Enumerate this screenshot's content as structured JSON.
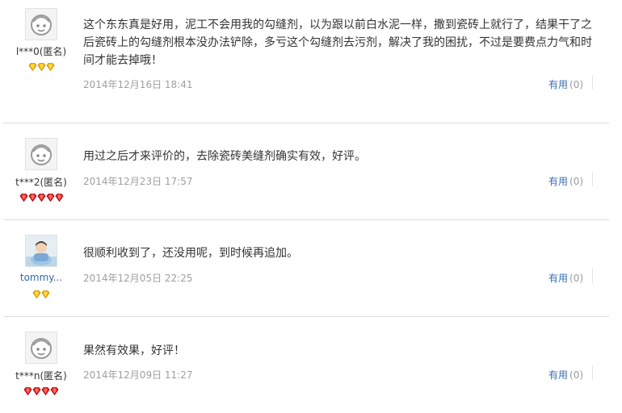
{
  "reviews": [
    {
      "username": "l***0(匿名)",
      "avatar_icon": "default-face-icon",
      "level_icon": "gold-diamond-icon",
      "level_count": 3,
      "content": "这个东东真是好用，泥工不会用我的勾缝剂，以为跟以前白水泥一样，撒到瓷砖上就行了，结果干了之后瓷砖上的勾缝剂根本没办法铲除，多亏这个勾缝剂去污剂，解决了我的困扰，不过是要费点力气和时间才能去掉哦！",
      "date": "2014年12月16日 18:41",
      "useful_label": "有用",
      "useful_count": "(0)"
    },
    {
      "username": "t***2(匿名)",
      "avatar_icon": "default-face-icon",
      "level_icon": "red-heart-icon",
      "level_count": 5,
      "content": "用过之后才来评价的，去除瓷砖美缝剂确实有效，好评。",
      "date": "2014年12月23日 17:57",
      "useful_label": "有用",
      "useful_count": "(0)"
    },
    {
      "username": "tommy...",
      "avatar_icon": "child-photo-icon",
      "level_icon": "gold-diamond-icon",
      "level_count": 2,
      "content": "很顺利收到了，还没用呢，到时候再追加。",
      "date": "2014年12月05日 22:25",
      "useful_label": "有用",
      "useful_count": "(0)"
    },
    {
      "username": "t***n(匿名)",
      "avatar_icon": "default-face-icon",
      "level_icon": "red-heart-icon",
      "level_count": 4,
      "content": "果然有效果，好评！",
      "date": "2014年12月09日 11:27",
      "useful_label": "有用",
      "useful_count": "(0)"
    }
  ],
  "colors": {
    "link_blue": "#3a6fb0",
    "date_gray": "#a0a0a0",
    "separator": "#dddddd",
    "gold": "#f2b705",
    "heart_red": "#e02020"
  }
}
